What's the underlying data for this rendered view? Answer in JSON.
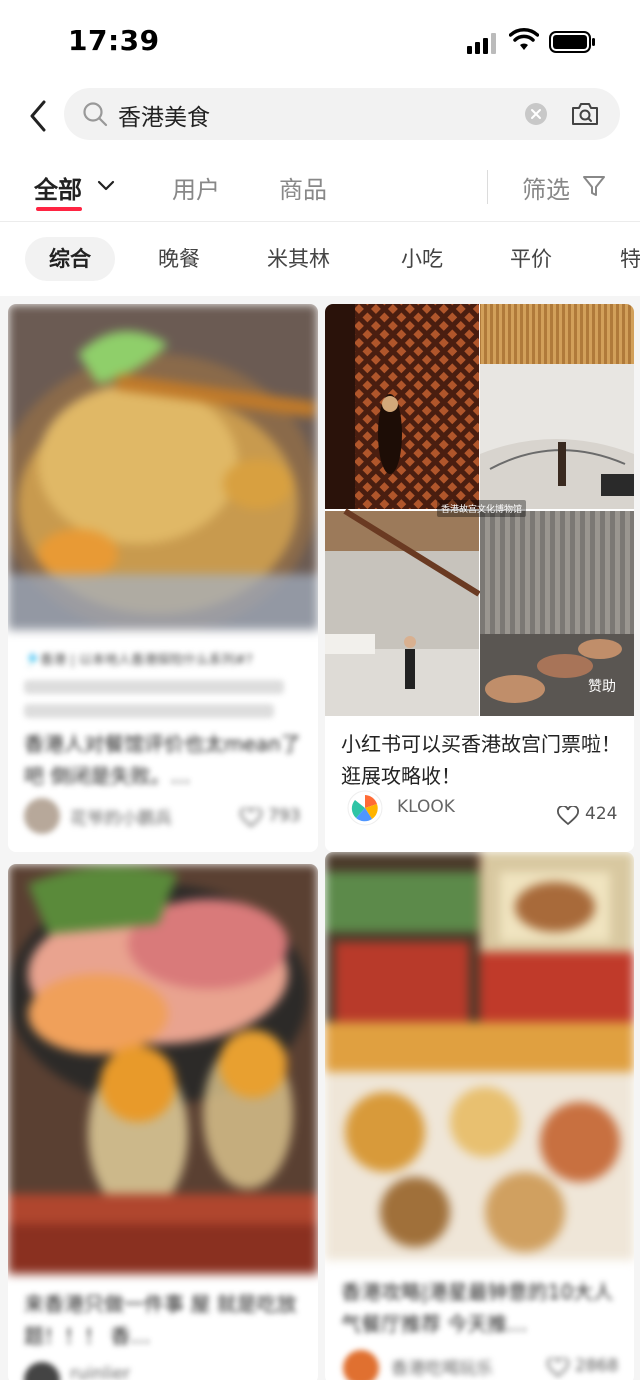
{
  "status": {
    "time": "17:39"
  },
  "search": {
    "query": "香港美食"
  },
  "tabs": {
    "all": "全部",
    "users": "用户",
    "products": "商品",
    "filter": "筛选"
  },
  "chips": [
    "综合",
    "晚餐",
    "米其林",
    "小吃",
    "平价",
    "特"
  ],
  "feed": {
    "card1": {
      "title": "香港人对餐馆评价也太mean了吧 倒闭是失败。…",
      "author": "花爷的小鹏兵",
      "likes": "793",
      "tags": "🎐香港 | 以本地人香港探险什么系列#?"
    },
    "card2": {
      "title": "小红书可以买香港故宫门票啦！逛展攻略收！",
      "author": "KLOOK",
      "likes": "424",
      "sponsor": "赞助",
      "place": "香港故宫文化博物馆"
    },
    "card3": {
      "title": "来香港只做一件事 屋 就是吃放题！！！ 香…",
      "author": "ruinlier"
    },
    "card4": {
      "title": "香港攻略|港星最钟意的10大人气餐厅推荐 今天推…",
      "author": "香港吃喝玩乐",
      "likes": "2868"
    }
  },
  "colors": {
    "accent": "#ff2442",
    "background": "#f5f5f5"
  }
}
